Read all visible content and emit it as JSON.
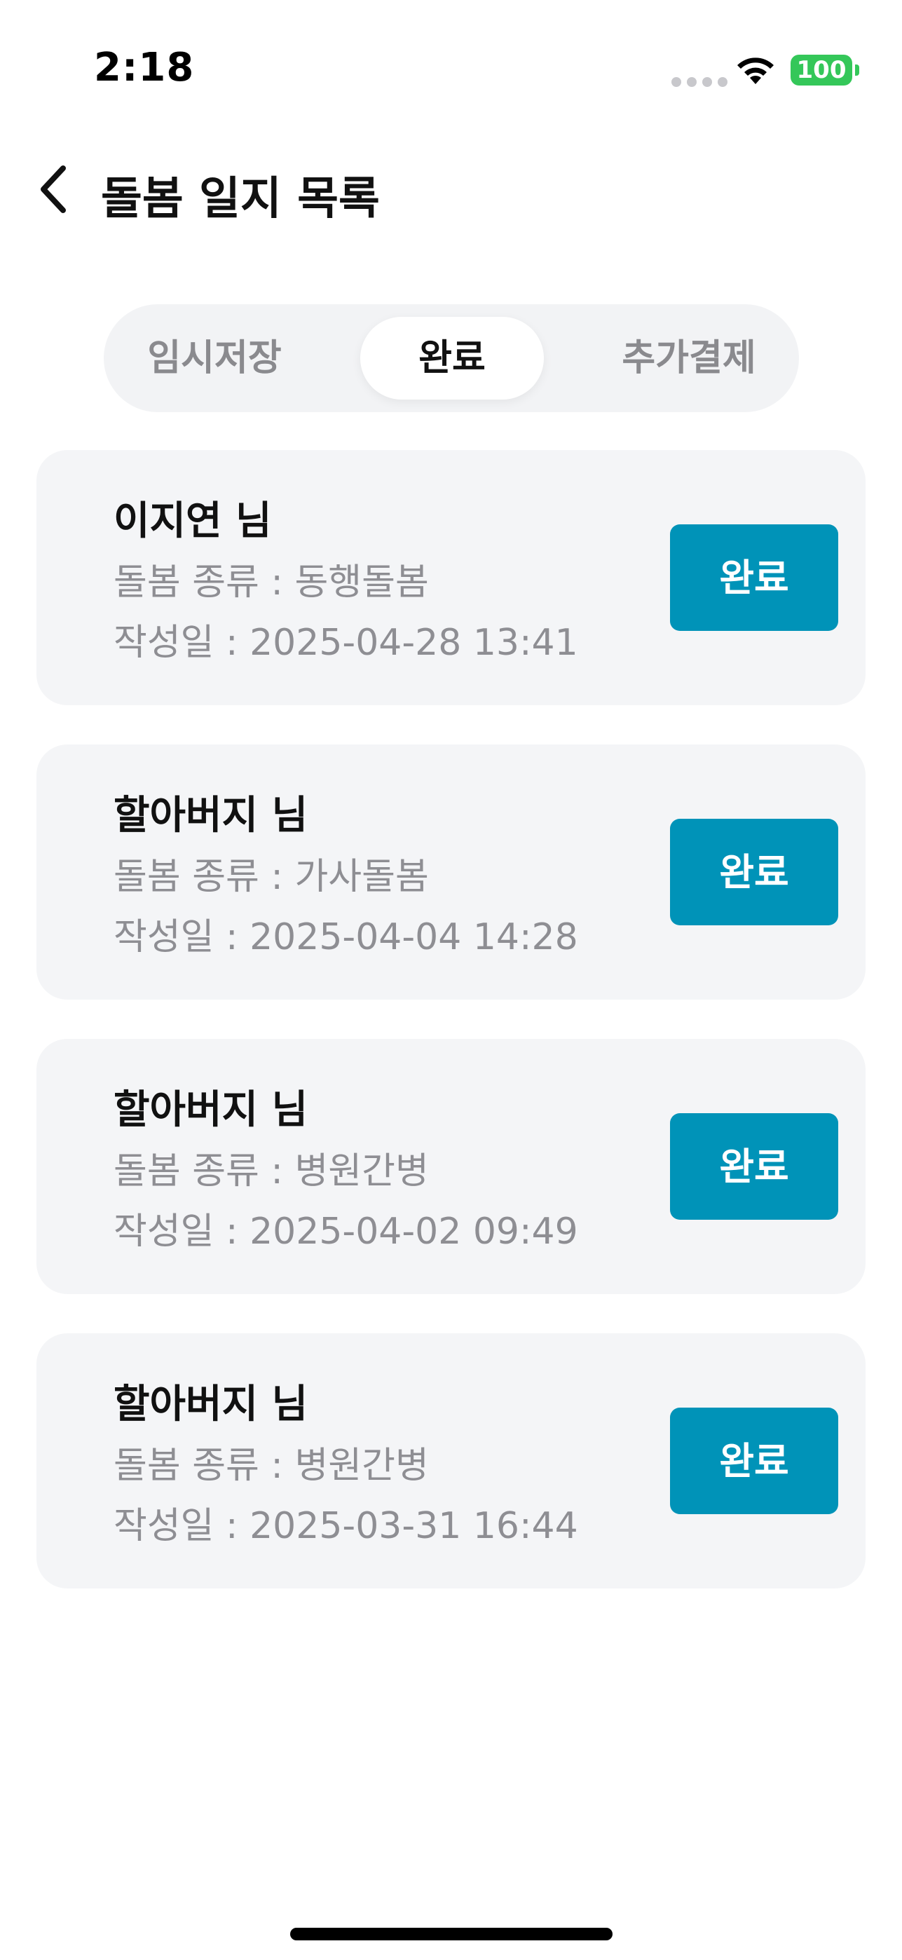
{
  "status_bar": {
    "time": "2:18",
    "battery": "100",
    "battery_color": "#34c759"
  },
  "header": {
    "title": "돌봄 일지 목록",
    "back_icon": "chevron-left-icon"
  },
  "tabs": [
    {
      "label": "임시저장",
      "active": false
    },
    {
      "label": "완료",
      "active": true
    },
    {
      "label": "추가결제",
      "active": false
    }
  ],
  "records": [
    {
      "name": "이지연 님",
      "type": "돌봄 종류 : 동행돌봄",
      "date": "작성일 : 2025-04-28 13:41",
      "status": "완료"
    },
    {
      "name": "할아버지 님",
      "type": "돌봄 종류 : 가사돌봄",
      "date": "작성일 : 2025-04-04 14:28",
      "status": "완료"
    },
    {
      "name": "할아버지 님",
      "type": "돌봄 종류 : 병원간병",
      "date": "작성일 : 2025-04-02 09:49",
      "status": "완료"
    },
    {
      "name": "할아버지 님",
      "type": "돌봄 종류 : 병원간병",
      "date": "작성일 : 2025-03-31 16:44",
      "status": "완료"
    }
  ],
  "colors": {
    "accent": "#0093b8",
    "card_bg": "#f4f5f7",
    "tab_bg": "#f2f3f5",
    "muted_text": "#8e8e93"
  }
}
